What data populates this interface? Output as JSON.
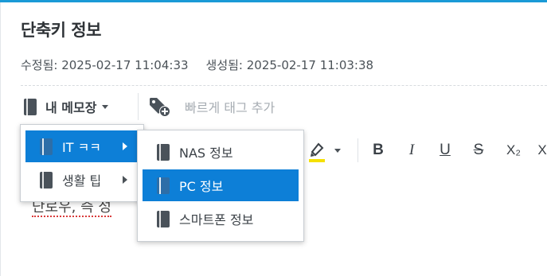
{
  "note": {
    "title": "단축키 정보",
    "modified": "수정됨: 2025-02-17 11:04:33",
    "created": "생성됨: 2025-02-17 11:03:38"
  },
  "toolbar": {
    "notebook_label": "내 메모장",
    "tag_placeholder": "빠르게 태그 추가"
  },
  "editor": {
    "visible_text": "단로우, 즉 성"
  },
  "menu_notebooks": {
    "items": [
      {
        "label": "IT ㅋㅋ",
        "icon": "notebook-icon",
        "has_submenu": true,
        "active": true
      },
      {
        "label": "생활 팁",
        "icon": "notebook-icon",
        "has_submenu": true,
        "active": false
      }
    ]
  },
  "submenu_it": {
    "items": [
      {
        "label": "NAS 정보",
        "icon": "notebook-icon",
        "active": false
      },
      {
        "label": "PC 정보",
        "icon": "notebook-icon",
        "active": true
      },
      {
        "label": "스마트폰 정보",
        "icon": "notebook-icon",
        "active": false
      }
    ]
  },
  "format_toolbar": {
    "bold": "B",
    "italic": "I",
    "underline": "U",
    "strikethrough": "S",
    "subscript": "X₂",
    "more": "X"
  },
  "colors": {
    "accent": "#1a9ad6",
    "menu_active": "#0d7fd7",
    "highlight_bar": "#f5e000"
  }
}
